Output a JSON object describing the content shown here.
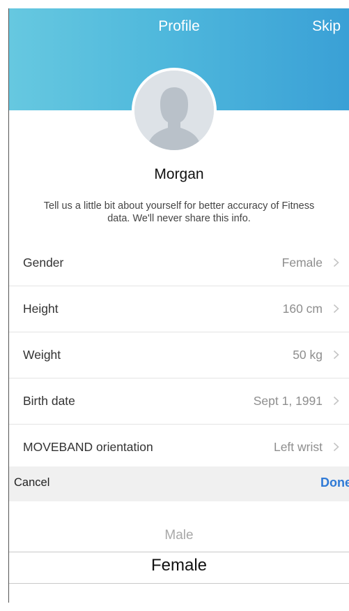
{
  "header": {
    "title": "Profile",
    "skip_label": "Skip"
  },
  "user": {
    "name": "Morgan"
  },
  "description": "Tell us a little bit about yourself for better accuracy of Fitness data. We'll never share this info.",
  "fields": [
    {
      "label": "Gender",
      "value": "Female"
    },
    {
      "label": "Height",
      "value": "160 cm"
    },
    {
      "label": "Weight",
      "value": "50 kg"
    },
    {
      "label": "Birth date",
      "value": "Sept 1, 1991"
    },
    {
      "label": "MOVEBAND orientation",
      "value": "Left wrist"
    }
  ],
  "picker_toolbar": {
    "cancel_label": "Cancel",
    "done_label": "Done"
  },
  "picker": {
    "previous_option": "Male",
    "selected_option": "Female"
  },
  "colors": {
    "header_start": "#66c8e0",
    "header_end": "#3aa0d6",
    "done": "#2f7ad6"
  }
}
